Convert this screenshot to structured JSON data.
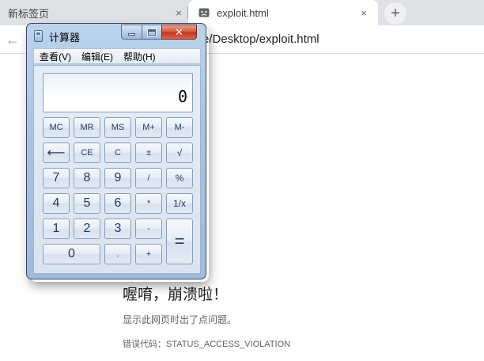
{
  "browser": {
    "tabs": [
      {
        "label": "新标签页",
        "close": "×"
      },
      {
        "label": "exploit.html",
        "close": "×"
      }
    ],
    "new_tab": "+",
    "back": "←",
    "address_visible": "e/Desktop/exploit.html"
  },
  "error_page": {
    "title": "喔唷，崩溃啦！",
    "description": "显示此网页时出了点问题。",
    "code": "错误代码：STATUS_ACCESS_VIOLATION"
  },
  "calculator": {
    "title": "计算器",
    "close_glyph": "✕",
    "menu": [
      "查看(V)",
      "编辑(E)",
      "帮助(H)"
    ],
    "display": "0",
    "buttons": {
      "mc": "MC",
      "mr": "MR",
      "ms": "MS",
      "mplus": "M+",
      "mminus": "M-",
      "back": "⟵",
      "ce": "CE",
      "c": "C",
      "plusminus": "±",
      "sqrt": "√",
      "seven": "7",
      "eight": "8",
      "nine": "9",
      "divide": "/",
      "percent": "%",
      "four": "4",
      "five": "5",
      "six": "6",
      "multiply": "*",
      "reciprocal": "1/x",
      "one": "1",
      "two": "2",
      "three": "3",
      "minus": "-",
      "equals": "=",
      "zero": "0",
      "dot": ".",
      "plus": "+"
    }
  },
  "colors": {
    "tabstrip": "#dee1e6",
    "calc_frame": "#a9c4e3",
    "close_red": "#c2351d",
    "button_text": "#1e395b"
  },
  "icons": {
    "tab_favicon": "crashed-page-icon",
    "calc_app": "calculator-icon"
  }
}
